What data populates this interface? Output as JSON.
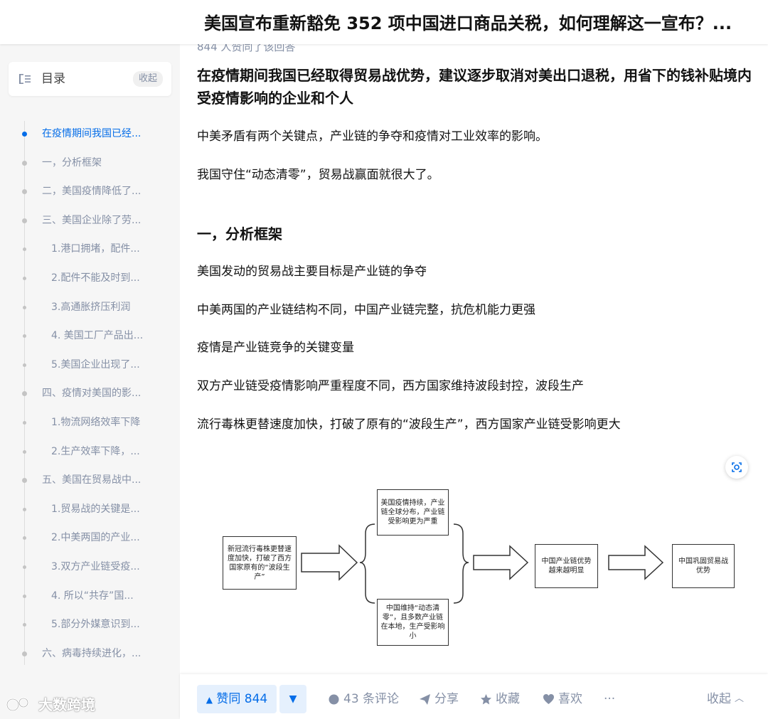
{
  "header": {
    "title": "美国宣布重新豁免 352 项中国进口商品关税，如何理解这一宣布？..."
  },
  "sidebar": {
    "toc_label": "目录",
    "collapse_label": "收起",
    "items": [
      {
        "label": "在疫情期间我国已经...",
        "active": true,
        "level": 1
      },
      {
        "label": "一，分析框架",
        "active": false,
        "level": 1
      },
      {
        "label": "二，美国疫情降低了...",
        "active": false,
        "level": 1
      },
      {
        "label": "三、美国企业除了劳...",
        "active": false,
        "level": 1
      },
      {
        "label": "1.港口拥堵，配件...",
        "active": false,
        "level": 2
      },
      {
        "label": "2.配件不能及时到...",
        "active": false,
        "level": 2
      },
      {
        "label": "3.高通胀挤压利润",
        "active": false,
        "level": 2
      },
      {
        "label": "4. 美国工厂产品出...",
        "active": false,
        "level": 2
      },
      {
        "label": "5.美国企业出现了...",
        "active": false,
        "level": 2
      },
      {
        "label": "四、疫情对美国的影...",
        "active": false,
        "level": 1
      },
      {
        "label": "1.物流网络效率下降",
        "active": false,
        "level": 2
      },
      {
        "label": "2.生产效率下降，...",
        "active": false,
        "level": 2
      },
      {
        "label": "五、美国在贸易战中...",
        "active": false,
        "level": 1
      },
      {
        "label": "1.贸易战的关键是...",
        "active": false,
        "level": 2
      },
      {
        "label": "2.中美两国的产业...",
        "active": false,
        "level": 2
      },
      {
        "label": "3.双方产业链受疫...",
        "active": false,
        "level": 2
      },
      {
        "label": "4. 所以“共存”国...",
        "active": false,
        "level": 2
      },
      {
        "label": "5.部分外媒意识到...",
        "active": false,
        "level": 2
      },
      {
        "label": "六、病毒持续进化，...",
        "active": false,
        "level": 1
      }
    ]
  },
  "watermark": {
    "text": "大数跨境"
  },
  "answer": {
    "upvote_note": "844 人赞同了该回答",
    "heading": "在疫情期间我国已经取得贸易战优势，建议逐步取消对美出口退税，用省下的钱补贴境内受疫情影响的企业和个人",
    "intro_1": "中美矛盾有两个关键点，产业链的争夺和疫情对工业效率的影响。",
    "intro_2": "我国守住“动态清零”，贸易战赢面就很大了。",
    "section_title": "一，分析框架",
    "points": [
      "美国发动的贸易战主要目标是产业链的争夺",
      "中美两国的产业链结构不同，中国产业链完整，抗危机能力更强",
      "疫情是产业链竞争的关键变量",
      "双方产业链受疫情影响严重程度不同，西方国家维持波段封控，波段生产",
      "流行毒株更替速度加快，打破了原有的“波段生产”，西方国家产业链受影响更大"
    ],
    "diagram": {
      "box_start": "新冠流行毒株更替速度加快，打破了西方国家原有的“波段生产”",
      "box_us": "美国疫情持续，产业链全球分布，产业链受影响更为严重",
      "box_cn": "中国维持“动态清零”，且多数产业链在本地，生产受影响小",
      "box_mid": "中国产业链优势越来越明显",
      "box_end": "中国巩固贸易战优势"
    }
  },
  "actions": {
    "upvote_label": "赞同 844",
    "comments_label": "43 条评论",
    "share_label": "分享",
    "favorite_label": "收藏",
    "like_label": "喜欢",
    "more_label": "···",
    "collapse_label": "收起",
    "accent_color": "#056de8"
  }
}
